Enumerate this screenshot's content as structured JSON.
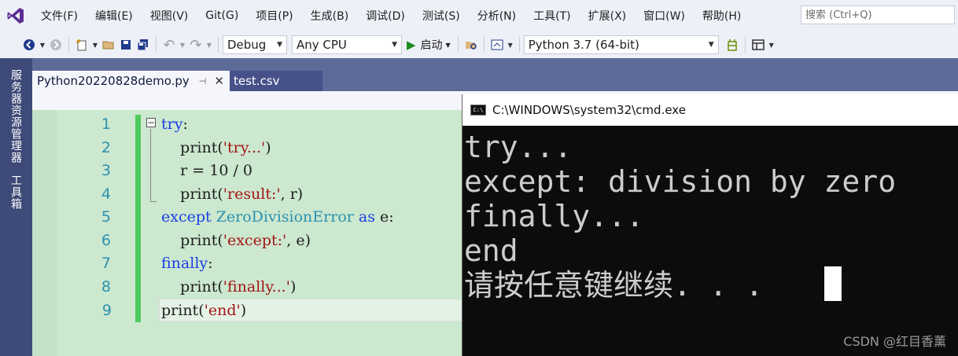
{
  "menubar": {
    "items": [
      "文件(F)",
      "编辑(E)",
      "视图(V)",
      "Git(G)",
      "项目(P)",
      "生成(B)",
      "调试(D)",
      "测试(S)",
      "分析(N)",
      "工具(T)",
      "扩展(X)",
      "窗口(W)",
      "帮助(H)"
    ],
    "search_placeholder": "搜索 (Ctrl+Q)"
  },
  "toolbar": {
    "config": "Debug",
    "platform": "Any CPU",
    "start_label": "启动",
    "environment": "Python 3.7 (64-bit)"
  },
  "side_tabs": [
    "服务器资源管理器",
    "工具箱"
  ],
  "tabs": [
    {
      "label": "Python20220828demo.py",
      "active": true
    },
    {
      "label": "test.csv",
      "active": false
    }
  ],
  "editor": {
    "line_numbers": [
      "1",
      "2",
      "3",
      "4",
      "5",
      "6",
      "7",
      "8",
      "9"
    ],
    "lines": [
      {
        "tokens": [
          {
            "t": "try",
            "k": "kw"
          },
          {
            "t": ":",
            "k": "plain"
          }
        ]
      },
      {
        "tokens": [
          {
            "t": "    print(",
            "k": "plain"
          },
          {
            "t": "'try...'",
            "k": "str"
          },
          {
            "t": ")",
            "k": "plain"
          }
        ]
      },
      {
        "tokens": [
          {
            "t": "    r = 10 / 0",
            "k": "plain"
          }
        ]
      },
      {
        "tokens": [
          {
            "t": "    print(",
            "k": "plain"
          },
          {
            "t": "'result:'",
            "k": "str"
          },
          {
            "t": ", r)",
            "k": "plain"
          }
        ]
      },
      {
        "tokens": [
          {
            "t": "except ",
            "k": "kw"
          },
          {
            "t": "ZeroDivisionError",
            "k": "cls"
          },
          {
            "t": " ",
            "k": "plain"
          },
          {
            "t": "as",
            "k": "kw"
          },
          {
            "t": " e:",
            "k": "plain"
          }
        ]
      },
      {
        "tokens": [
          {
            "t": "    print(",
            "k": "plain"
          },
          {
            "t": "'except:'",
            "k": "str"
          },
          {
            "t": ", e)",
            "k": "plain"
          }
        ]
      },
      {
        "tokens": [
          {
            "t": "finally",
            "k": "kw"
          },
          {
            "t": ":",
            "k": "plain"
          }
        ]
      },
      {
        "tokens": [
          {
            "t": "    print(",
            "k": "plain"
          },
          {
            "t": "'finally...'",
            "k": "str"
          },
          {
            "t": ")",
            "k": "plain"
          }
        ]
      },
      {
        "tokens": [
          {
            "t": "print(",
            "k": "plain"
          },
          {
            "t": "'end'",
            "k": "str"
          },
          {
            "t": ")",
            "k": "plain"
          }
        ]
      }
    ]
  },
  "console": {
    "title": "C:\\WINDOWS\\system32\\cmd.exe",
    "lines": [
      "try...",
      "except: division by zero",
      "finally...",
      "end",
      "请按任意键继续. . . "
    ]
  },
  "watermark": "CSDN @红目香薰",
  "colors": {
    "keyword": "#1a3fe3",
    "string": "#a31515",
    "class": "#2b91af",
    "editor_bg": "#cce8cf",
    "console_bg": "#0c0c0c"
  }
}
